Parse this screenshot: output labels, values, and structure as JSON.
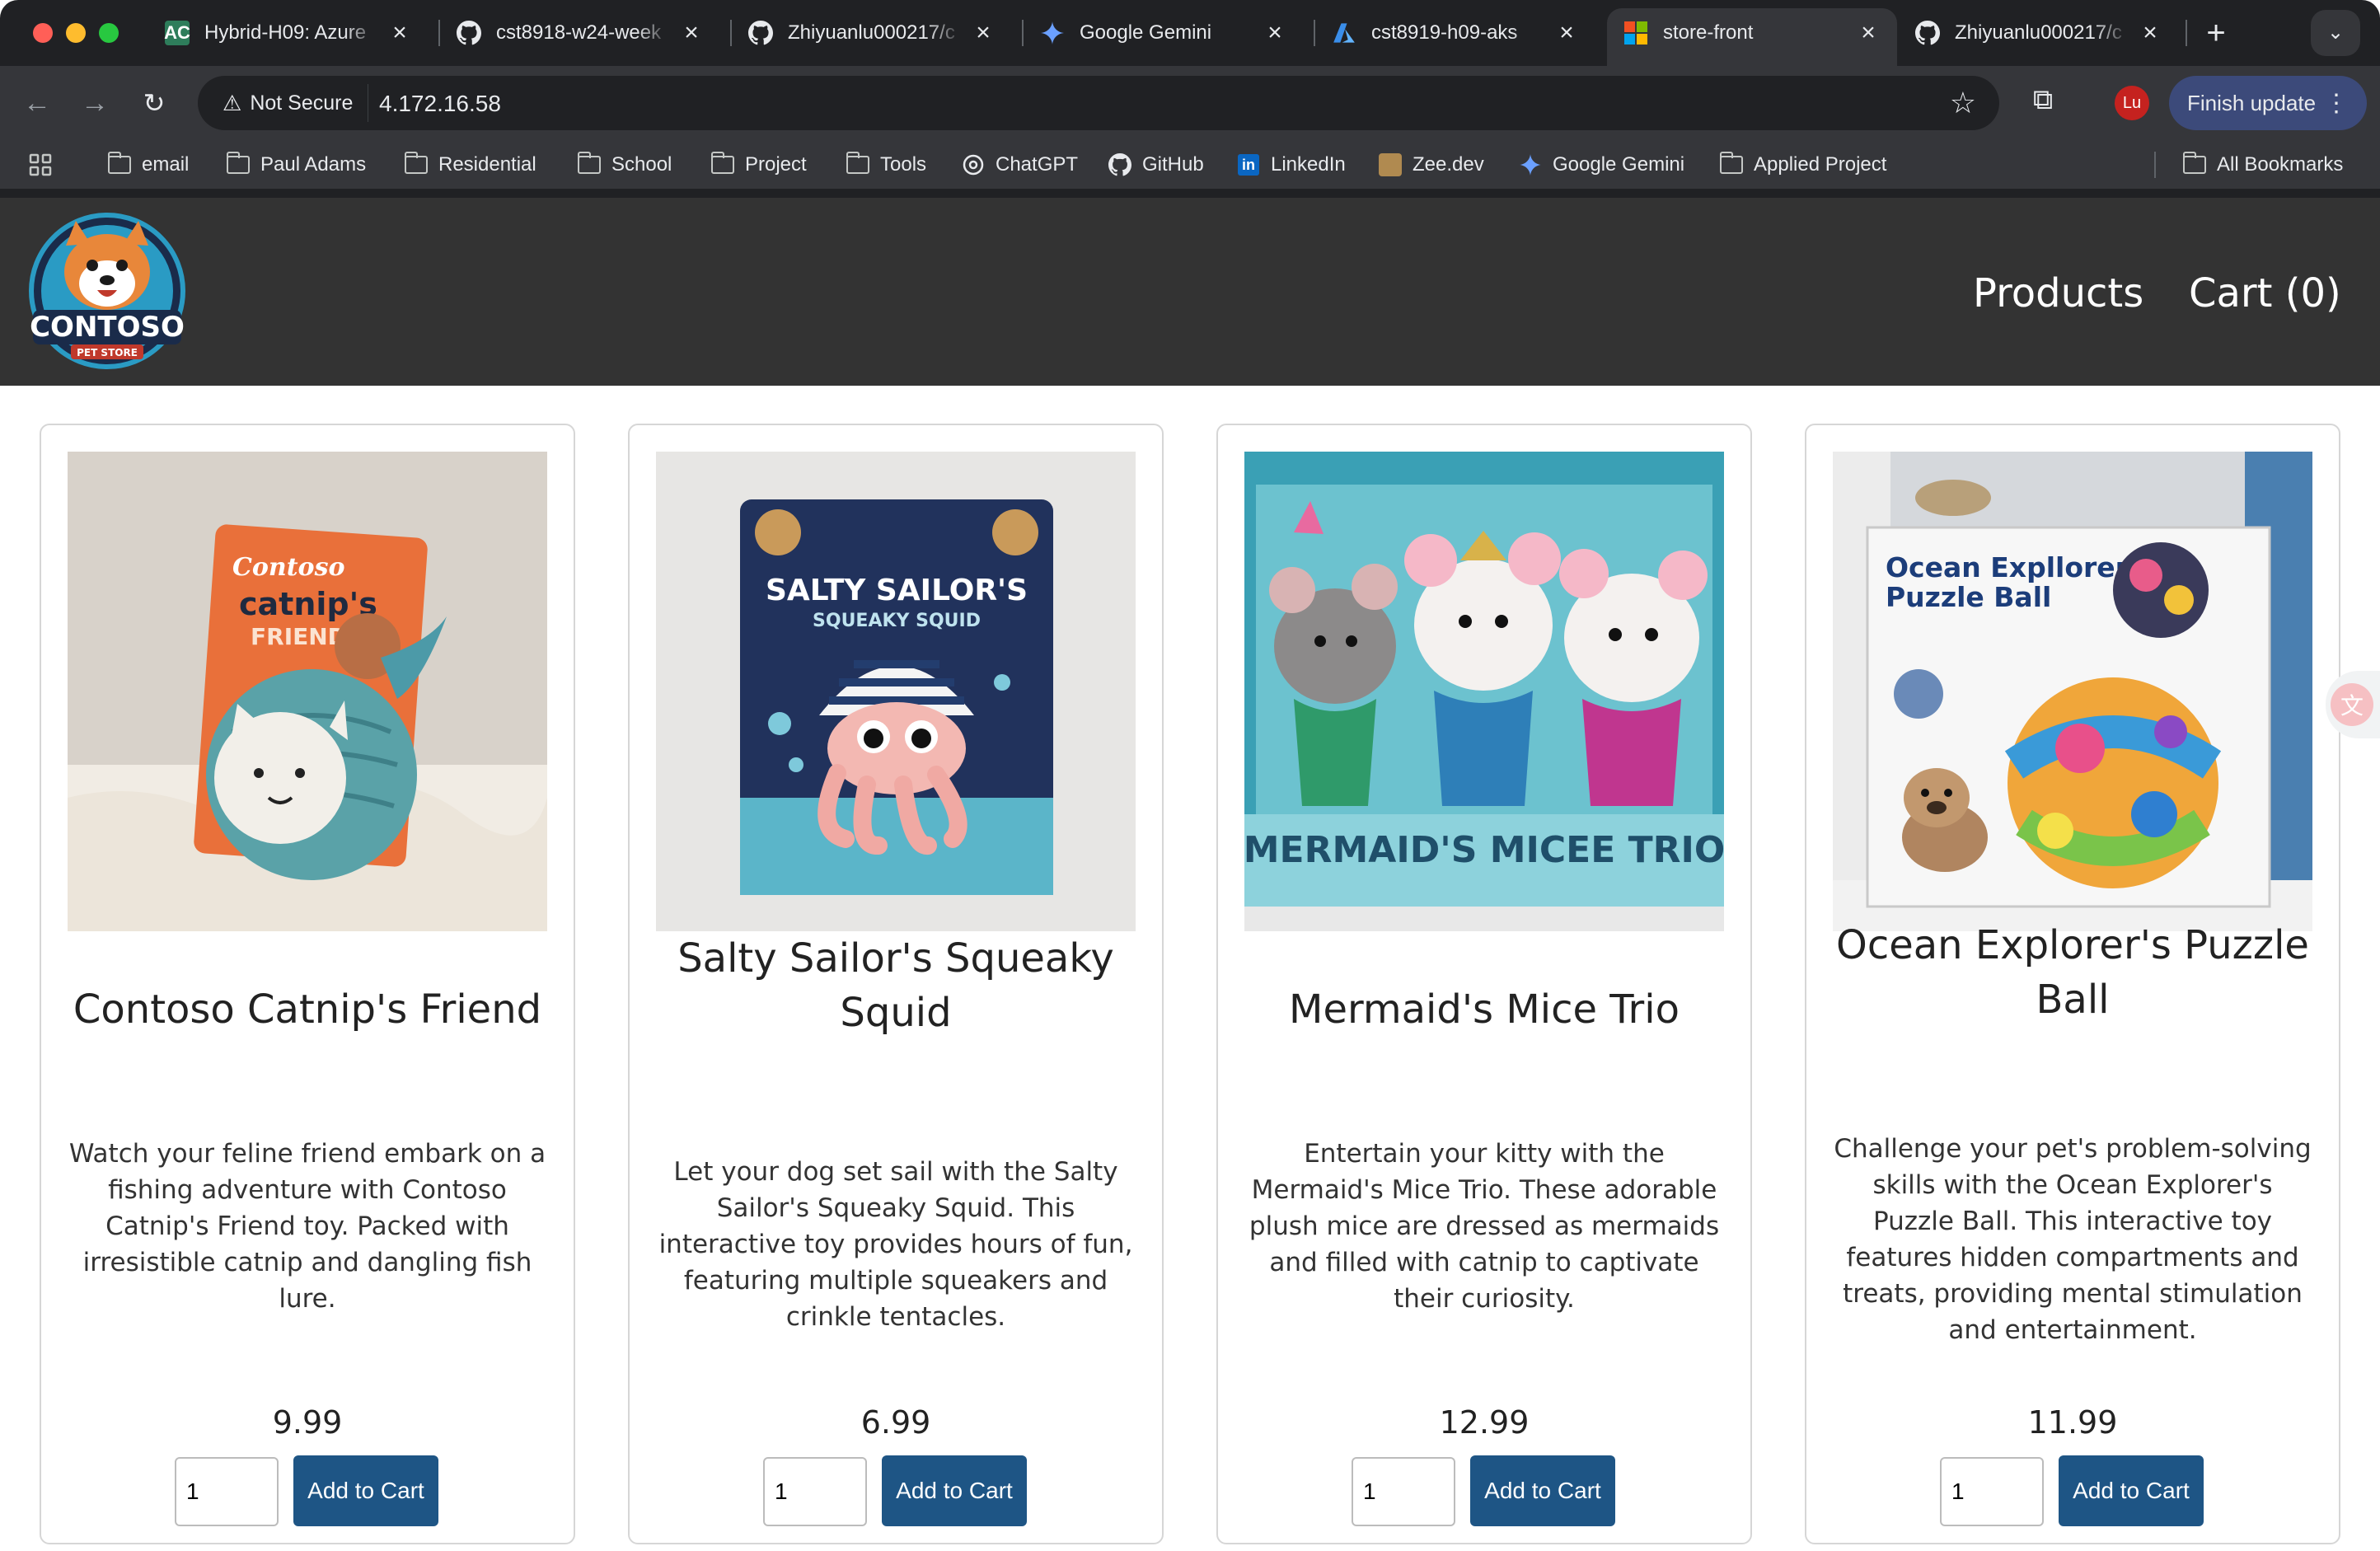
{
  "browser": {
    "tabs": [
      {
        "title": "Hybrid-H09: Azure",
        "icon": "arcs-icon",
        "active": false
      },
      {
        "title": "cst8918-w24-week",
        "icon": "github-icon",
        "active": false
      },
      {
        "title": "Zhiyuanlu000217/c",
        "icon": "github-icon",
        "active": false
      },
      {
        "title": "Google Gemini",
        "icon": "gemini-icon",
        "active": false
      },
      {
        "title": "cst8919-h09-aks",
        "icon": "azure-icon",
        "active": false
      },
      {
        "title": "store-front",
        "icon": "microsoft-icon",
        "active": true
      },
      {
        "title": "Zhiyuanlu000217/c",
        "icon": "github-icon",
        "active": false
      }
    ],
    "security_label": "Not Secure",
    "url": "4.172.16.58",
    "avatar_initials": "Lu",
    "finish_update_label": "Finish update",
    "bookmarks": [
      {
        "label": "email",
        "icon": "folder-icon"
      },
      {
        "label": "Paul Adams",
        "icon": "folder-icon"
      },
      {
        "label": "Residential",
        "icon": "folder-icon"
      },
      {
        "label": "School",
        "icon": "folder-icon"
      },
      {
        "label": "Project",
        "icon": "folder-icon"
      },
      {
        "label": "Tools",
        "icon": "folder-icon"
      },
      {
        "label": "ChatGPT",
        "icon": "chatgpt-icon"
      },
      {
        "label": "GitHub",
        "icon": "github-icon"
      },
      {
        "label": "LinkedIn",
        "icon": "linkedin-icon"
      },
      {
        "label": "Zee.dev",
        "icon": "zee-icon"
      },
      {
        "label": "Google Gemini",
        "icon": "gemini-icon"
      },
      {
        "label": "Applied Project",
        "icon": "folder-icon"
      }
    ],
    "all_bookmarks_label": "All Bookmarks"
  },
  "site": {
    "brand": "CONTOSO",
    "brand_sub": "PET STORE",
    "nav": {
      "products": "Products",
      "cart": "Cart (0)"
    }
  },
  "products": [
    {
      "name": "Contoso Catnip's Friend",
      "description": "Watch your feline friend embark on a fishing adventure with Contoso Catnip's Friend toy. Packed with irresistible catnip and dangling fish lure.",
      "price": "9.99",
      "qty": "1",
      "button": "Add to Cart",
      "packaging_text": [
        "Contoso",
        "catnip's",
        "FRIEND"
      ]
    },
    {
      "name": "Salty Sailor's Squeaky Squid",
      "description": "Let your dog set sail with the Salty Sailor's Squeaky Squid. This interactive toy provides hours of fun, featuring multiple squeakers and crinkle tentacles.",
      "price": "6.99",
      "qty": "1",
      "button": "Add to Cart",
      "packaging_text": [
        "SALTY SAILOR'S",
        "SQUEAKY SQUID"
      ]
    },
    {
      "name": "Mermaid's Mice Trio",
      "description": "Entertain your kitty with the Mermaid's Mice Trio. These adorable plush mice are dressed as mermaids and filled with catnip to captivate their curiosity.",
      "price": "12.99",
      "qty": "1",
      "button": "Add to Cart",
      "packaging_text": [
        "MERMAID'S MICEE TRIO"
      ]
    },
    {
      "name": "Ocean Explorer's Puzzle Ball",
      "description": "Challenge your pet's problem-solving skills with the Ocean Explorer's Puzzle Ball. This interactive toy features hidden compartments and treats, providing mental stimulation and entertainment.",
      "price": "11.99",
      "qty": "1",
      "button": "Add to Cart",
      "packaging_text": [
        "Ocean Expllorer's",
        "Puzzle Ball"
      ]
    }
  ]
}
